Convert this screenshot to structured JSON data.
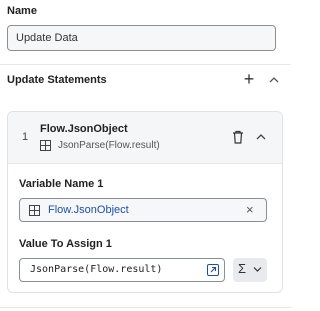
{
  "name_section": {
    "label": "Name",
    "value": "Update Data"
  },
  "update_statements": {
    "title": "Update Statements",
    "add_icon": "plus-icon",
    "collapse_icon": "chevron-up-icon"
  },
  "statement": {
    "index": "1",
    "title": "Flow.JsonObject",
    "subtitle": "JsonParse(Flow.result)",
    "variable": {
      "label": "Variable Name 1",
      "value": "Flow.JsonObject"
    },
    "assign": {
      "label": "Value To Assign 1",
      "value": "JsonParse(Flow.result)"
    },
    "formula_symbol": "Σ"
  },
  "colors": {
    "link_blue": "#1f4fa3",
    "border": "#8a8f96",
    "header_bg": "#f5f6f8"
  }
}
